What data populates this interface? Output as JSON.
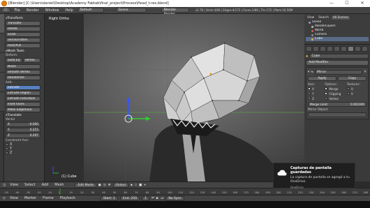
{
  "window": {
    "title": "[Blender] [C:\\Users\\daniel\\Desktop\\Academy Fabtab\\final_project\\Process\\Head_t-rex.blend]",
    "minimize": "—",
    "maximize": "☐",
    "close": "✕"
  },
  "infobar": {
    "menus": [
      "File",
      "Render",
      "Window",
      "Help"
    ],
    "layout": "Default",
    "scene": "Scene",
    "engine": "Blender Render",
    "stats": "v2.78 | Verts:4/80 | Edges:4/172 | Faces:1/86 | Tris:172 | Mem:16.56M"
  },
  "toolshelf": {
    "transform_header": "Transform",
    "transform_buttons": [
      "Translate",
      "Rotate",
      "Scale",
      "Shrink/Fatten",
      "Push/Pull"
    ],
    "mesh_tools_header": "Mesh Tools",
    "deform_label": "Deform:",
    "deform_row": [
      "Slide Ed",
      "Vertex"
    ],
    "deform_buttons": [
      "Noise",
      "Smooth Vertex",
      "Randomize"
    ],
    "add_label": "Add:",
    "extrude": "Extrude",
    "add_buttons": [
      "Extrude Region",
      "Extrude Individual",
      "Inset Faces",
      "Make Edge/Face"
    ],
    "translate_header": "Translate",
    "vector_label": "Vector",
    "vector": [
      {
        "axis": "X",
        "value": "-0.000"
      },
      {
        "axis": "Y",
        "value": "0.215"
      },
      {
        "axis": "Z",
        "value": "0.297"
      }
    ],
    "constraint_label": "Constraint Axis",
    "constraints": [
      "X",
      "Y",
      "Z"
    ]
  },
  "viewport": {
    "view_name": "Right Ortho",
    "object_label": "(1) Cube"
  },
  "outliner": {
    "tabs": [
      "View",
      "Search",
      "All Scenes"
    ],
    "items": [
      {
        "name": "Scene",
        "color": "#8aa0c8"
      },
      {
        "name": "RenderLayers",
        "color": "#bbbbbb"
      },
      {
        "name": "World",
        "color": "#d35a5a"
      },
      {
        "name": "Camera",
        "color": "#8c8c8c"
      },
      {
        "name": "Cube",
        "color": "#e0b040"
      }
    ]
  },
  "properties": {
    "object_name": "Cube",
    "add_modifier": "Add Modifier",
    "modifier_name": "Mirror",
    "apply": "Apply",
    "copy": "Copy",
    "axis_header": "Axis:",
    "options_header": "Options:",
    "textures_header": "Textures:",
    "axis": [
      {
        "label": "X",
        "on": true
      },
      {
        "label": "Y",
        "on": false
      },
      {
        "label": "Z",
        "on": false
      }
    ],
    "options": [
      {
        "label": "Merge",
        "on": true
      },
      {
        "label": "Clipping",
        "on": true
      },
      {
        "label": "Vertex",
        "on": false
      }
    ],
    "textures": [
      {
        "label": "U",
        "on": false
      },
      {
        "label": "V",
        "on": false
      }
    ],
    "merge_limit_label": "Merge Limit:",
    "merge_limit_value": "0.001000",
    "mirror_object": "Mirror Object:"
  },
  "viewport_header": {
    "items": [
      "View",
      "Select",
      "Add",
      "Mesh"
    ],
    "mode": "Edit Mode",
    "pivot": "Global"
  },
  "timeline": {
    "ticks": [
      "-50",
      "-40",
      "-30",
      "-20",
      "-10",
      "0",
      "10",
      "20",
      "30",
      "40",
      "50",
      "60",
      "70",
      "80",
      "90",
      "100",
      "110",
      "120",
      "130",
      "140",
      "150",
      "160",
      "170",
      "180",
      "190",
      "200",
      "210",
      "220",
      "230",
      "240",
      "250",
      "260",
      "270",
      "280"
    ],
    "menus": [
      "View",
      "Marker",
      "Frame",
      "Playback"
    ],
    "start_label": "Start:",
    "start": "1",
    "end_label": "End:",
    "end": "250",
    "current": "1",
    "sync": "No Sync"
  },
  "notification": {
    "title": "Capturas de pantalla guardadas",
    "body": "La captura de pantalla se agregó a tu OneDrive.",
    "source": "OneDrive"
  }
}
